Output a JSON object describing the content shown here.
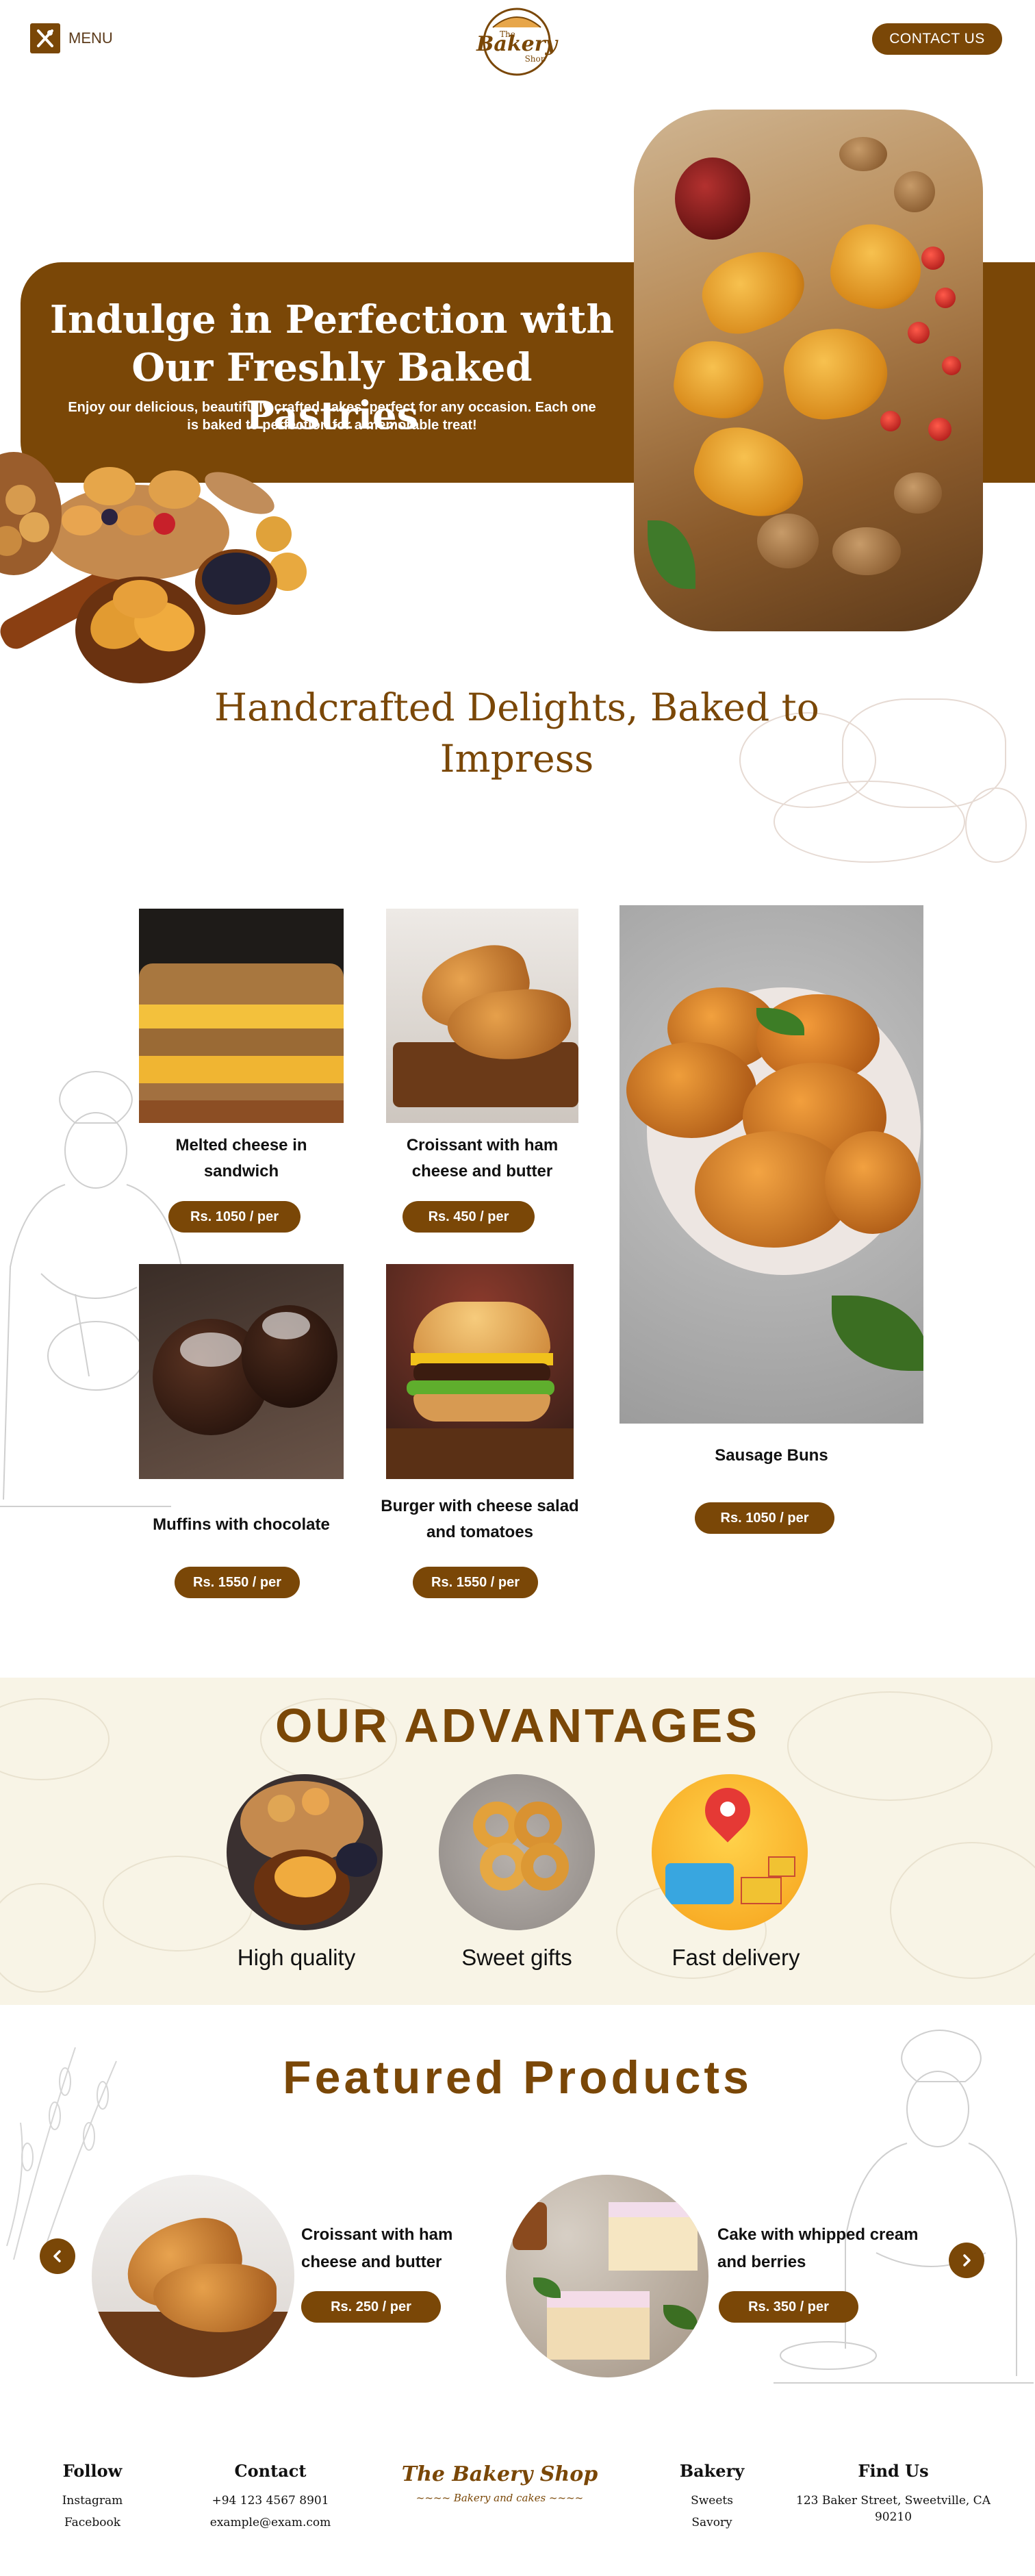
{
  "header": {
    "menu_label": "MENU",
    "logo_text_top": "The",
    "logo_text_main": "Bakery",
    "logo_text_bottom": "Shop",
    "contact_label": "CONTACT US"
  },
  "hero": {
    "title": "Indulge in Perfection with Our Freshly Baked Pastries",
    "subtitle": "Enjoy our delicious, beautifully crafted cakes, perfect for any occasion. Each one is baked to perfection for a memorable treat!"
  },
  "handcrafted": {
    "title": "Handcrafted Delights, Baked to Impress",
    "products": [
      {
        "name": "Melted cheese in sandwich",
        "price": "Rs. 1050 / per"
      },
      {
        "name": "Croissant with ham cheese and butter",
        "price": "Rs. 450 / per"
      },
      {
        "name": "Sausage Buns",
        "price": "Rs. 1050 / per"
      },
      {
        "name": "Muffins with chocolate",
        "price": "Rs. 1550 / per"
      },
      {
        "name": "Burger with cheese salad and tomatoes",
        "price": "Rs. 1550 / per"
      }
    ]
  },
  "advantages": {
    "title": "OUR ADVANTAGES",
    "items": [
      {
        "label": "High quality"
      },
      {
        "label": "Sweet gifts"
      },
      {
        "label": "Fast delivery"
      }
    ]
  },
  "featured": {
    "title": "Featured Products",
    "items": [
      {
        "name": "Croissant with ham cheese and butter",
        "price": "Rs. 250 / per"
      },
      {
        "name": "Cake with whipped cream and berries",
        "price": "Rs. 350 / per"
      }
    ]
  },
  "footer": {
    "follow": {
      "title": "Follow",
      "items": [
        "Instagram",
        "Facebook"
      ]
    },
    "contact": {
      "title": "Contact",
      "items": [
        "+94 123 4567 8901",
        "example@exam.com"
      ]
    },
    "brand": {
      "name": "The Bakery Shop",
      "tagline": "Bakery and cakes"
    },
    "bakery": {
      "title": "Bakery",
      "items": [
        "Sweets",
        "Savory"
      ]
    },
    "find_us": {
      "title": "Find Us",
      "address": "123 Baker Street, Sweetville, CA 90210"
    }
  },
  "colors": {
    "accent": "#7a4707",
    "cream": "#f8f4e6"
  }
}
